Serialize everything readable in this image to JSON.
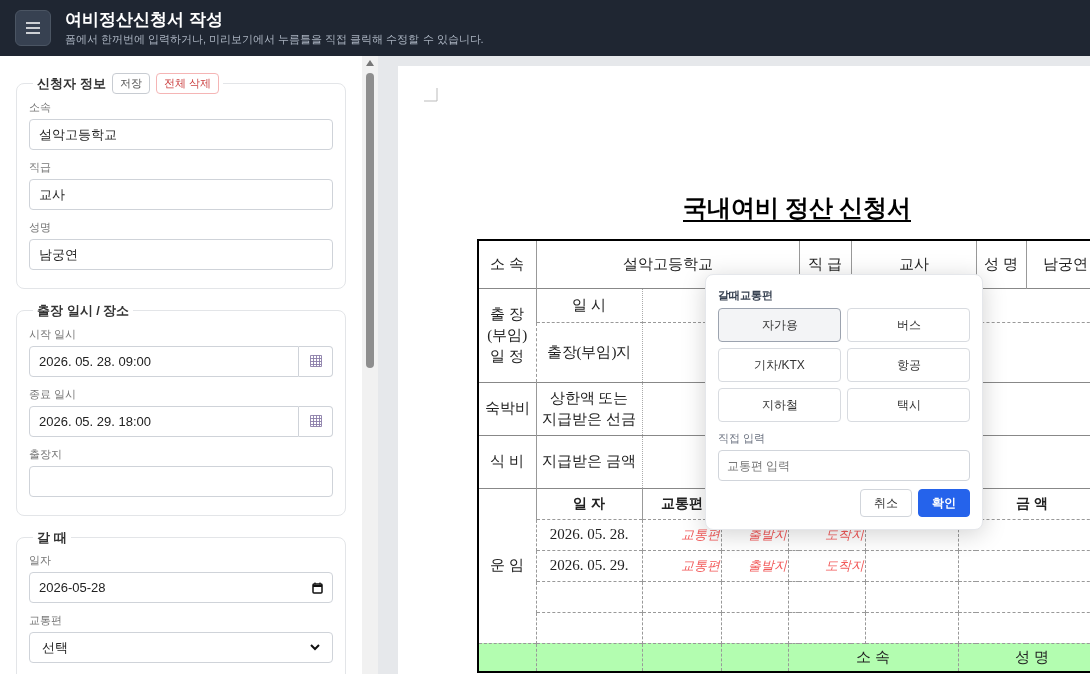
{
  "header": {
    "title": "여비정산신청서 작성",
    "subtitle": "폼에서 한꺼번에 입력하거나, 미리보기에서 누름틀을 직접 클릭해 수정할 수 있습니다."
  },
  "form": {
    "sections": [
      {
        "legend": "신청자 정보",
        "buttons": [
          {
            "label": "저장",
            "kind": "normal"
          },
          {
            "label": "전체 삭제",
            "kind": "danger"
          }
        ],
        "fields": [
          {
            "label": "소속",
            "kind": "text",
            "value": "설악고등학교"
          },
          {
            "label": "직급",
            "kind": "text",
            "value": "교사"
          },
          {
            "label": "성명",
            "kind": "text",
            "value": "남궁연"
          }
        ]
      },
      {
        "legend": "출장 일시 / 장소",
        "fields": [
          {
            "label": "시작 일시",
            "kind": "datetime",
            "value": "2026. 05. 28. 09:00"
          },
          {
            "label": "종료 일시",
            "kind": "datetime",
            "value": "2026. 05. 29. 18:00"
          },
          {
            "label": "출장지",
            "kind": "text"
          }
        ]
      },
      {
        "legend": "갈 때",
        "fields": [
          {
            "label": "일자",
            "kind": "date",
            "value": "2026-05-28"
          },
          {
            "label": "교통편",
            "kind": "select",
            "value": "선택"
          }
        ]
      }
    ]
  },
  "document": {
    "title": "국내여비 정산 신청서",
    "rows": [
      {
        "kind": "main",
        "cells": [
          {
            "kind": "label",
            "text": "소    속"
          },
          {
            "kind": "value",
            "text": "설악고등학교",
            "colspan": 4
          },
          {
            "kind": "label",
            "text": "직 급"
          },
          {
            "kind": "value",
            "text": "교사",
            "colspan": 3
          },
          {
            "kind": "label",
            "text": "성 명"
          },
          {
            "kind": "value",
            "text": "남궁연"
          }
        ]
      },
      {
        "kind": "main",
        "cells": [
          {
            "kind": "label",
            "text": "출 장\n(부임)\n일 정",
            "rowspan": 2
          },
          {
            "kind": "label",
            "text": "일    시"
          },
          {
            "kind": "empty",
            "colspan": 9
          }
        ]
      },
      {
        "kind": "sub",
        "cells": [
          {
            "kind": "label",
            "text": "출장(부임)지"
          },
          {
            "kind": "empty",
            "colspan": 9
          }
        ]
      },
      {
        "kind": "main",
        "cells": [
          {
            "kind": "label",
            "text": "숙박비"
          },
          {
            "kind": "label",
            "text": "상한액 또는\n지급받은 선금"
          },
          {
            "kind": "empty",
            "colspan": 9
          }
        ]
      },
      {
        "kind": "main",
        "cells": [
          {
            "kind": "label",
            "text": "식  비"
          },
          {
            "kind": "label",
            "text": "지급받은 금액"
          },
          {
            "kind": "empty",
            "colspan": 9
          }
        ]
      },
      {
        "kind": "main",
        "cells": [
          {
            "kind": "label",
            "text": "운  임",
            "rowspan": 5
          },
          {
            "kind": "header",
            "text": "일 자"
          },
          {
            "kind": "header",
            "text": "교통편"
          },
          {
            "kind": "empty"
          },
          {
            "kind": "empty",
            "colspan": 3
          },
          {
            "kind": "empty"
          },
          {
            "kind": "header",
            "text": "금  액",
            "colspan": 3
          }
        ]
      },
      {
        "kind": "sub",
        "cells": [
          {
            "kind": "value",
            "text": "2026. 05. 28."
          },
          {
            "kind": "entry",
            "text": "교통편"
          },
          {
            "kind": "entry",
            "text": "출발지"
          },
          {
            "kind": "entry",
            "text": "도착지",
            "colspan": 3
          },
          {
            "kind": "empty"
          },
          {
            "kind": "empty",
            "colspan": 3
          }
        ]
      },
      {
        "kind": "sub",
        "cells": [
          {
            "kind": "value",
            "text": "2026. 05. 29."
          },
          {
            "kind": "entry",
            "text": "교통편"
          },
          {
            "kind": "entry",
            "text": "출발지"
          },
          {
            "kind": "entry",
            "text": "도착지",
            "colspan": 3
          },
          {
            "kind": "empty"
          },
          {
            "kind": "empty",
            "colspan": 3
          }
        ]
      },
      {
        "kind": "sub",
        "cells": [
          {
            "kind": "empty"
          },
          {
            "kind": "empty"
          },
          {
            "kind": "empty"
          },
          {
            "kind": "empty",
            "colspan": 3
          },
          {
            "kind": "empty"
          },
          {
            "kind": "empty",
            "colspan": 3
          }
        ]
      },
      {
        "kind": "sub",
        "cells": [
          {
            "kind": "empty"
          },
          {
            "kind": "empty"
          },
          {
            "kind": "empty"
          },
          {
            "kind": "empty",
            "colspan": 3
          },
          {
            "kind": "empty"
          },
          {
            "kind": "empty",
            "colspan": 3
          }
        ]
      },
      {
        "kind": "signature",
        "cells": [
          {
            "kind": "empty"
          },
          {
            "kind": "empty"
          },
          {
            "kind": "empty"
          },
          {
            "kind": "empty"
          },
          {
            "kind": "value",
            "text": "소  속",
            "colspan": 4
          },
          {
            "kind": "value",
            "text": "성  명",
            "colspan": 3
          }
        ]
      }
    ]
  },
  "popup": {
    "title": "갈때교통편",
    "options": [
      {
        "label": "자가용",
        "selected": true
      },
      {
        "label": "버스",
        "selected": false
      },
      {
        "label": "기차/KTX",
        "selected": false
      },
      {
        "label": "항공",
        "selected": false
      },
      {
        "label": "지하철",
        "selected": false
      },
      {
        "label": "택시",
        "selected": false
      }
    ],
    "custom_label": "직접 입력",
    "custom_placeholder": "교통편 입력",
    "buttons": [
      {
        "label": "취소",
        "kind": "secondary"
      },
      {
        "label": "확인",
        "kind": "primary"
      }
    ]
  }
}
